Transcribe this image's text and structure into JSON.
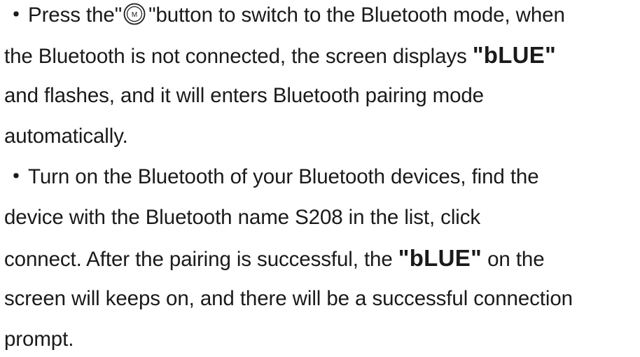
{
  "doc": {
    "p1": {
      "bullet": "・",
      "l1a": "Press the\"",
      "icon_name": "m-button-icon",
      "icon_letter": "M",
      "l1b": "\"button to switch to the Bluetooth mode, when",
      "l2a": "the Bluetooth is not connected, the screen displays ",
      "l2em": "\"bLUE\"",
      "l3": "and flashes, and it will enters Bluetooth pairing mode",
      "l4": "automatically."
    },
    "p2": {
      "bullet": "・",
      "l1": "Turn on the Bluetooth of your Bluetooth devices, find the",
      "l2": "device with the Bluetooth name S208 in the list, click",
      "l3a": "connect. After the pairing is successful, the ",
      "l3em": "\"bLUE\"",
      "l3b": " on the",
      "l4": "screen will keeps on, and there will be a successful connection",
      "l5": "prompt."
    }
  }
}
